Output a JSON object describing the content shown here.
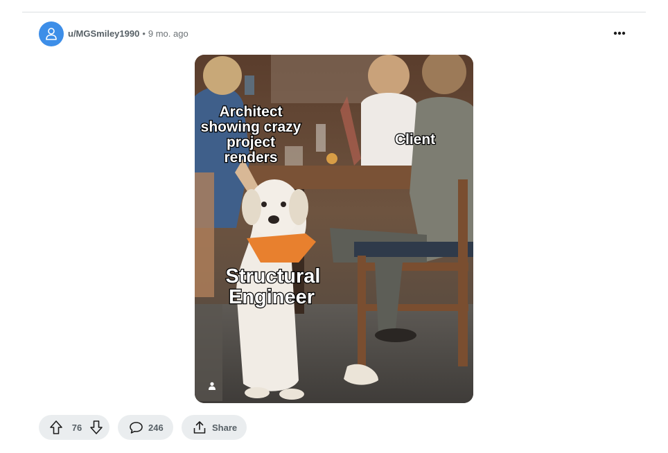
{
  "post": {
    "username": "u/MGSmiley1990",
    "separator": "•",
    "age": "9 mo. ago"
  },
  "meme": {
    "label_architect": [
      "Architect",
      "showing crazy",
      "project",
      "renders"
    ],
    "label_client": "Client",
    "label_engineer": [
      "Structural",
      "Engineer"
    ]
  },
  "actions": {
    "upvotes": "76",
    "comments": "246",
    "share_label": "Share"
  },
  "icons": {
    "avatar": "user-avatar-icon",
    "more": "more-options-icon",
    "upvote": "arrow-up-icon",
    "downvote": "arrow-down-icon",
    "comment": "comment-bubble-icon",
    "share": "share-upload-icon",
    "user_tag": "person-icon"
  },
  "colors": {
    "avatar": "#3d8ee8",
    "pill_bg": "#eaedef",
    "text_muted": "#576066"
  }
}
